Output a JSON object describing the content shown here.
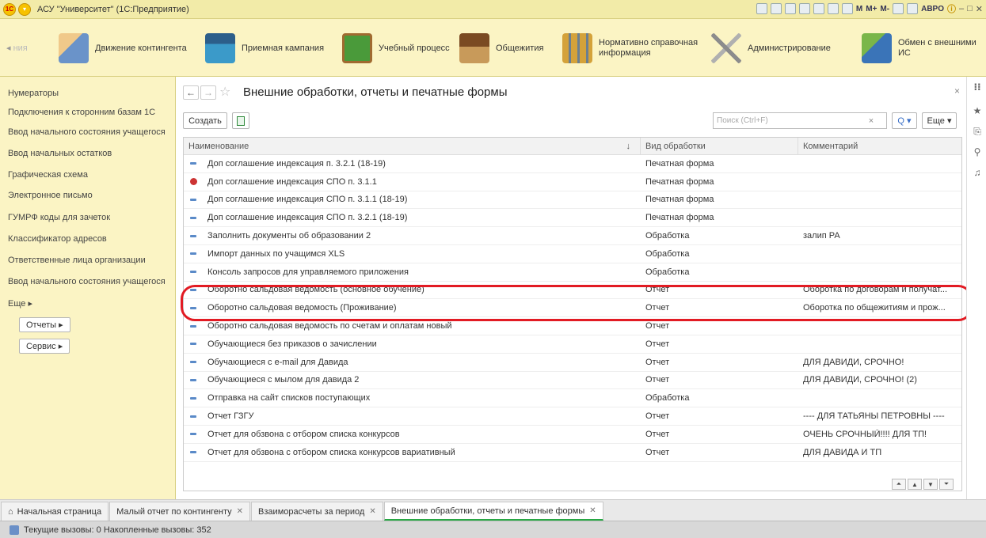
{
  "window": {
    "logo": "1C",
    "title": "АСУ \"Университет\" (1С:Предприятие)",
    "user": "ABPO"
  },
  "sections": {
    "cut_label": "ния",
    "items": [
      {
        "label": "Движение контингента",
        "icon": "people-card-icon",
        "color": "#6a93c9"
      },
      {
        "label": "Приемная кампания",
        "icon": "graduate-arrow-icon",
        "color": "#3b9ac9"
      },
      {
        "label": "Учебный процесс",
        "icon": "chalkboard-icon",
        "color": "#4a9a3a"
      },
      {
        "label": "Общежития",
        "icon": "house-icon",
        "color": "#b97a40"
      },
      {
        "label": "Нормативно справочная\nинформация",
        "icon": "books-icon",
        "color": "#d4a23a"
      },
      {
        "label": "Администрирование",
        "icon": "tools-icon",
        "color": "#8c8c8c"
      },
      {
        "label": "Обмен с внешними ИС",
        "icon": "exchange-icon",
        "color": "#3a74b8"
      }
    ]
  },
  "sidebar": {
    "items": [
      "Нумераторы",
      "Подключения к сторонним базам 1С",
      "Ввод начального состояния учащегося",
      "Ввод начальных остатков",
      "Графическая схема",
      "Электронное письмо",
      "ГУМРФ коды для зачеток",
      "Классификатор адресов",
      "Ответственные лица организации",
      "Ввод начального состояния учащегося",
      "Еще ▸"
    ],
    "buttons": [
      "Отчеты ▸",
      "Сервис ▸"
    ]
  },
  "form": {
    "title": "Внешние обработки, отчеты и печатные формы",
    "create_label": "Создать",
    "search_placeholder": "Поиск (Ctrl+F)",
    "more_label": "Еще ▾",
    "search_btn": "Q ▾",
    "clear_btn": "×"
  },
  "table": {
    "columns": [
      "Наименование",
      "Вид обработки",
      "Комментарий"
    ],
    "sort_indicator": "↓",
    "rows": [
      {
        "name": "Доп соглашение индексация п. 3.2.1 (18-19)",
        "type": "Печатная форма",
        "comment": "",
        "deleted": false
      },
      {
        "name": "Доп соглашение индексация СПО п. 3.1.1",
        "type": "Печатная форма",
        "comment": "",
        "deleted": true
      },
      {
        "name": "Доп соглашение индексация СПО п. 3.1.1 (18-19)",
        "type": "Печатная форма",
        "comment": "",
        "deleted": false
      },
      {
        "name": "Доп соглашение индексация СПО п. 3.2.1 (18-19)",
        "type": "Печатная форма",
        "comment": "",
        "deleted": false
      },
      {
        "name": "Заполнить документы об образовании 2",
        "type": "Обработка",
        "comment": "залип РА",
        "deleted": false
      },
      {
        "name": "Импорт данных по учащимся XLS",
        "type": "Обработка",
        "comment": "",
        "deleted": false
      },
      {
        "name": "Консоль запросов для управляемого приложения",
        "type": "Обработка",
        "comment": "",
        "deleted": false
      },
      {
        "name": "Оборотно сальдовая ведомость (основное обучение)",
        "type": "Отчет",
        "comment": "Оборотка по договорам и получат...",
        "deleted": false
      },
      {
        "name": "Оборотно сальдовая ведомость (Проживание)",
        "type": "Отчет",
        "comment": "Оборотка по общежитиям и прож...",
        "deleted": false
      },
      {
        "name": "Оборотно сальдовая ведомость по счетам и оплатам новый",
        "type": "Отчет",
        "comment": "",
        "deleted": false
      },
      {
        "name": "Обучающиеся без приказов о зачислении",
        "type": "Отчет",
        "comment": "",
        "deleted": false
      },
      {
        "name": "Обучающиеся с e-mail для Давида",
        "type": "Отчет",
        "comment": "ДЛЯ ДАВИДИ, СРОЧНО!",
        "deleted": false
      },
      {
        "name": "Обучающиеся с мылом для давида 2",
        "type": "Отчет",
        "comment": "ДЛЯ ДАВИДИ, СРОЧНО! (2)",
        "deleted": false
      },
      {
        "name": "Отправка на сайт списков поступающих",
        "type": "Обработка",
        "comment": "",
        "deleted": false
      },
      {
        "name": "Отчет ГЗГУ",
        "type": "Отчет",
        "comment": "---- ДЛЯ ТАТЬЯНЫ ПЕТРОВНЫ ----",
        "deleted": false
      },
      {
        "name": "Отчет для обзвона с отбором списка конкурсов",
        "type": "Отчет",
        "comment": "ОЧЕНЬ СРОЧНЫЙ!!!! ДЛЯ ТП!",
        "deleted": false
      },
      {
        "name": "Отчет для обзвона с отбором списка конкурсов вариативный",
        "type": "Отчет",
        "comment": "ДЛЯ ДАВИДА И ТП",
        "deleted": false
      }
    ]
  },
  "tabs": [
    {
      "label": "Начальная страница",
      "closable": false,
      "active": false
    },
    {
      "label": "Малый отчет по контингенту",
      "closable": true,
      "active": false
    },
    {
      "label": "Взаиморасчеты за период",
      "closable": true,
      "active": false
    },
    {
      "label": "Внешние обработки, отчеты и печатные формы",
      "closable": true,
      "active": true
    }
  ],
  "status": {
    "text": "Текущие вызовы: 0   Накопленные вызовы: 352"
  }
}
